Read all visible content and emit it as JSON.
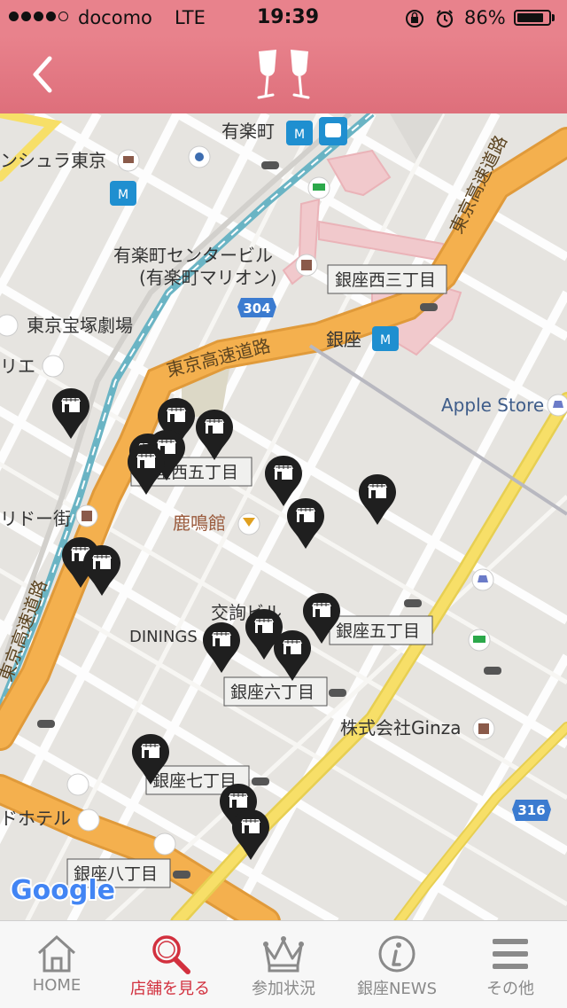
{
  "status_bar": {
    "carrier": "docomo",
    "network": "LTE",
    "time": "19:39",
    "battery": "86%",
    "signal_bars": 4,
    "battery_level": 0.86
  },
  "header": {
    "back_icon": "chevron-left-icon",
    "logo_icon": "champagne-glasses-icon",
    "bg_color": "#e8828c"
  },
  "map": {
    "labels": {
      "yurakucho": "有楽町",
      "peninsula": "ンシュラ東京",
      "yurakucho_center": "有楽町センタービル",
      "marion": "(有楽町マリオン)",
      "takarazuka": "東京宝塚劇場",
      "rie": "リエ",
      "corridor": "リドー街",
      "rokumeikan": "鹿鳴館",
      "kojunsha": "交詢ビル",
      "dinings": "DININGS",
      "apple_store": "Apple Store",
      "ginza": "銀座",
      "company": "株式会社Ginza",
      "hotel": "ドホテル",
      "expressway_center": "東京高速道路",
      "expressway_left": "東京高速道路",
      "expressway_top": "東京高速道路",
      "google": "Google"
    },
    "district_labels": {
      "nishi3": "銀座西三丁目",
      "nishi5": "座西五丁目",
      "go": "銀座五丁目",
      "roku": "銀座六丁目",
      "nana": "銀座七丁目",
      "hachi": "銀座八丁目"
    },
    "route_shields": {
      "r304": "304",
      "r316": "316"
    },
    "marker_icon": "shop-marker-icon"
  },
  "tabs": [
    {
      "label": "HOME",
      "icon": "home-icon",
      "active": false
    },
    {
      "label": "店舗を見る",
      "icon": "search-icon",
      "active": true
    },
    {
      "label": "参加状況",
      "icon": "crown-icon",
      "active": false
    },
    {
      "label": "銀座NEWS",
      "icon": "info-icon",
      "active": false
    },
    {
      "label": "その他",
      "icon": "menu-icon",
      "active": false
    }
  ]
}
